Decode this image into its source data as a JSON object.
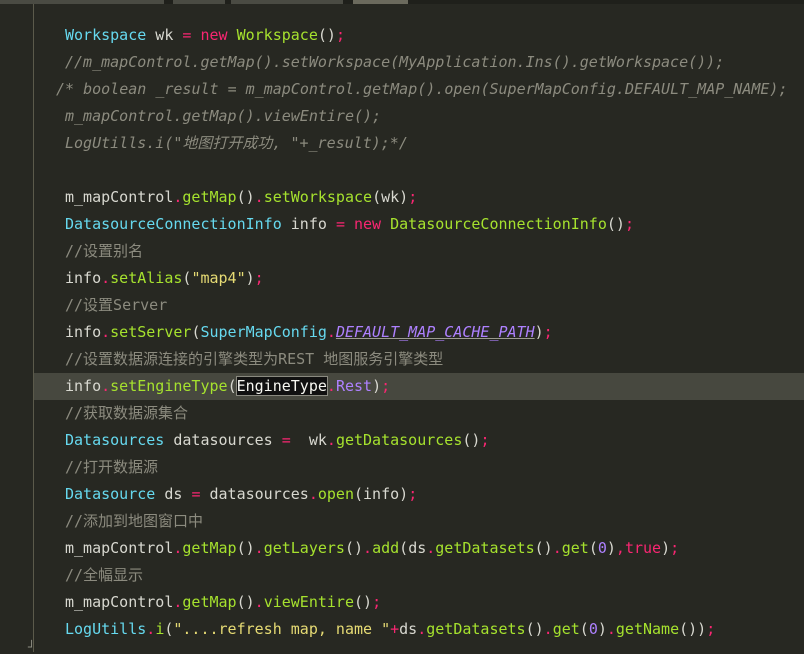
{
  "editor": {
    "lines": [
      [
        {
          "t": "Workspace",
          "c": "type"
        },
        {
          "t": " wk ",
          "c": "plain"
        },
        {
          "t": "=",
          "c": "kw"
        },
        {
          "t": " ",
          "c": "plain"
        },
        {
          "t": "new",
          "c": "kw"
        },
        {
          "t": " ",
          "c": "plain"
        },
        {
          "t": "Workspace",
          "c": "fn"
        },
        {
          "t": "()",
          "c": "paren"
        },
        {
          "t": ";",
          "c": "punc"
        }
      ],
      [
        {
          "t": "//m_mapControl.getMap().setWorkspace(MyApplication.Ins().getWorkspace());",
          "c": "comment it"
        }
      ],
      [
        {
          "t": "/* boolean _result = m_mapControl.getMap().open(SuperMapConfig.DEFAULT_MAP_NAME);",
          "c": "comment it",
          "block": true
        }
      ],
      [
        {
          "t": "m_mapControl.getMap().viewEntire();",
          "c": "comment it"
        }
      ],
      [
        {
          "t": "LogUtills.i(\"地图打开成功, \"+_result);*/",
          "c": "comment it"
        }
      ],
      [],
      [
        {
          "t": "m_mapControl",
          "c": "plain"
        },
        {
          "t": ".",
          "c": "punc"
        },
        {
          "t": "getMap",
          "c": "fn"
        },
        {
          "t": "()",
          "c": "paren"
        },
        {
          "t": ".",
          "c": "punc"
        },
        {
          "t": "setWorkspace",
          "c": "fn"
        },
        {
          "t": "(",
          "c": "paren"
        },
        {
          "t": "wk",
          "c": "plain"
        },
        {
          "t": ")",
          "c": "paren"
        },
        {
          "t": ";",
          "c": "punc"
        }
      ],
      [
        {
          "t": "DatasourceConnectionInfo",
          "c": "type"
        },
        {
          "t": " info ",
          "c": "plain"
        },
        {
          "t": "=",
          "c": "kw"
        },
        {
          "t": " ",
          "c": "plain"
        },
        {
          "t": "new",
          "c": "kw"
        },
        {
          "t": " ",
          "c": "plain"
        },
        {
          "t": "DatasourceConnectionInfo",
          "c": "fn"
        },
        {
          "t": "()",
          "c": "paren"
        },
        {
          "t": ";",
          "c": "punc"
        }
      ],
      [
        {
          "t": "//设置别名",
          "c": "comment"
        }
      ],
      [
        {
          "t": "info",
          "c": "plain"
        },
        {
          "t": ".",
          "c": "punc"
        },
        {
          "t": "setAlias",
          "c": "fn"
        },
        {
          "t": "(",
          "c": "paren"
        },
        {
          "t": "\"map4\"",
          "c": "str"
        },
        {
          "t": ")",
          "c": "paren"
        },
        {
          "t": ";",
          "c": "punc"
        }
      ],
      [
        {
          "t": "//设置Server",
          "c": "comment"
        }
      ],
      [
        {
          "t": "info",
          "c": "plain"
        },
        {
          "t": ".",
          "c": "punc"
        },
        {
          "t": "setServer",
          "c": "fn"
        },
        {
          "t": "(",
          "c": "paren"
        },
        {
          "t": "SuperMapConfig",
          "c": "type"
        },
        {
          "t": ".",
          "c": "punc"
        },
        {
          "t": "DEFAULT_MAP_CACHE_PATH",
          "c": "const"
        },
        {
          "t": ")",
          "c": "paren"
        },
        {
          "t": ";",
          "c": "punc"
        }
      ],
      [
        {
          "t": "//设置数据源连接的引擎类型为REST 地图服务引擎类型",
          "c": "comment"
        }
      ],
      [
        {
          "t": "info",
          "c": "plain"
        },
        {
          "t": ".",
          "c": "punc"
        },
        {
          "t": "setEngineType",
          "c": "fn"
        },
        {
          "t": "(",
          "c": "paren"
        },
        {
          "t": "EngineType",
          "c": "type sel"
        },
        {
          "t": ".",
          "c": "punc"
        },
        {
          "t": "Rest",
          "c": "num it"
        },
        {
          "t": ")",
          "c": "paren"
        },
        {
          "t": ";",
          "c": "punc"
        }
      ],
      [
        {
          "t": "//获取数据源集合",
          "c": "comment"
        }
      ],
      [
        {
          "t": "Datasources",
          "c": "type"
        },
        {
          "t": " datasources ",
          "c": "plain"
        },
        {
          "t": "=",
          "c": "kw"
        },
        {
          "t": "  wk",
          "c": "plain"
        },
        {
          "t": ".",
          "c": "punc"
        },
        {
          "t": "getDatasources",
          "c": "fn"
        },
        {
          "t": "()",
          "c": "paren"
        },
        {
          "t": ";",
          "c": "punc"
        }
      ],
      [
        {
          "t": "//打开数据源",
          "c": "comment"
        }
      ],
      [
        {
          "t": "Datasource",
          "c": "type"
        },
        {
          "t": " ds ",
          "c": "plain"
        },
        {
          "t": "=",
          "c": "kw"
        },
        {
          "t": " datasources",
          "c": "plain"
        },
        {
          "t": ".",
          "c": "punc"
        },
        {
          "t": "open",
          "c": "fn"
        },
        {
          "t": "(",
          "c": "paren"
        },
        {
          "t": "info",
          "c": "plain"
        },
        {
          "t": ")",
          "c": "paren"
        },
        {
          "t": ";",
          "c": "punc"
        }
      ],
      [
        {
          "t": "//添加到地图窗口中",
          "c": "comment"
        }
      ],
      [
        {
          "t": "m_mapControl",
          "c": "plain"
        },
        {
          "t": ".",
          "c": "punc"
        },
        {
          "t": "getMap",
          "c": "fn"
        },
        {
          "t": "()",
          "c": "paren"
        },
        {
          "t": ".",
          "c": "punc"
        },
        {
          "t": "getLayers",
          "c": "fn"
        },
        {
          "t": "()",
          "c": "paren"
        },
        {
          "t": ".",
          "c": "punc"
        },
        {
          "t": "add",
          "c": "fn"
        },
        {
          "t": "(",
          "c": "paren"
        },
        {
          "t": "ds",
          "c": "plain"
        },
        {
          "t": ".",
          "c": "punc"
        },
        {
          "t": "getDatasets",
          "c": "fn"
        },
        {
          "t": "()",
          "c": "paren"
        },
        {
          "t": ".",
          "c": "punc"
        },
        {
          "t": "get",
          "c": "fn"
        },
        {
          "t": "(",
          "c": "paren"
        },
        {
          "t": "0",
          "c": "num"
        },
        {
          "t": ")",
          "c": "paren"
        },
        {
          "t": ",",
          "c": "punc"
        },
        {
          "t": "true",
          "c": "kw"
        },
        {
          "t": ")",
          "c": "paren"
        },
        {
          "t": ";",
          "c": "punc"
        }
      ],
      [
        {
          "t": "//全幅显示",
          "c": "comment"
        }
      ],
      [
        {
          "t": "m_mapControl",
          "c": "plain"
        },
        {
          "t": ".",
          "c": "punc"
        },
        {
          "t": "getMap",
          "c": "fn"
        },
        {
          "t": "()",
          "c": "paren"
        },
        {
          "t": ".",
          "c": "punc"
        },
        {
          "t": "viewEntire",
          "c": "fn"
        },
        {
          "t": "()",
          "c": "paren"
        },
        {
          "t": ";",
          "c": "punc"
        }
      ],
      [
        {
          "t": "LogUtills",
          "c": "type"
        },
        {
          "t": ".",
          "c": "punc"
        },
        {
          "t": "i",
          "c": "fn"
        },
        {
          "t": "(",
          "c": "paren"
        },
        {
          "t": "\"....refresh map, name \"",
          "c": "str"
        },
        {
          "t": "+",
          "c": "kw"
        },
        {
          "t": "ds",
          "c": "plain"
        },
        {
          "t": ".",
          "c": "punc"
        },
        {
          "t": "getDatasets",
          "c": "fn"
        },
        {
          "t": "()",
          "c": "paren"
        },
        {
          "t": ".",
          "c": "punc"
        },
        {
          "t": "get",
          "c": "fn"
        },
        {
          "t": "(",
          "c": "paren"
        },
        {
          "t": "0",
          "c": "num"
        },
        {
          "t": ")",
          "c": "paren"
        },
        {
          "t": ".",
          "c": "punc"
        },
        {
          "t": "getName",
          "c": "fn"
        },
        {
          "t": "())",
          "c": "paren"
        },
        {
          "t": ";",
          "c": "punc"
        }
      ]
    ],
    "current_line": 13,
    "fold_mark": "┘"
  },
  "colors": {
    "background": "#272822",
    "type": "#66d9ef",
    "keyword": "#f92672",
    "function": "#a6e22e",
    "string": "#e6db74",
    "number": "#ae81ff",
    "comment": "#8c8b7f"
  }
}
